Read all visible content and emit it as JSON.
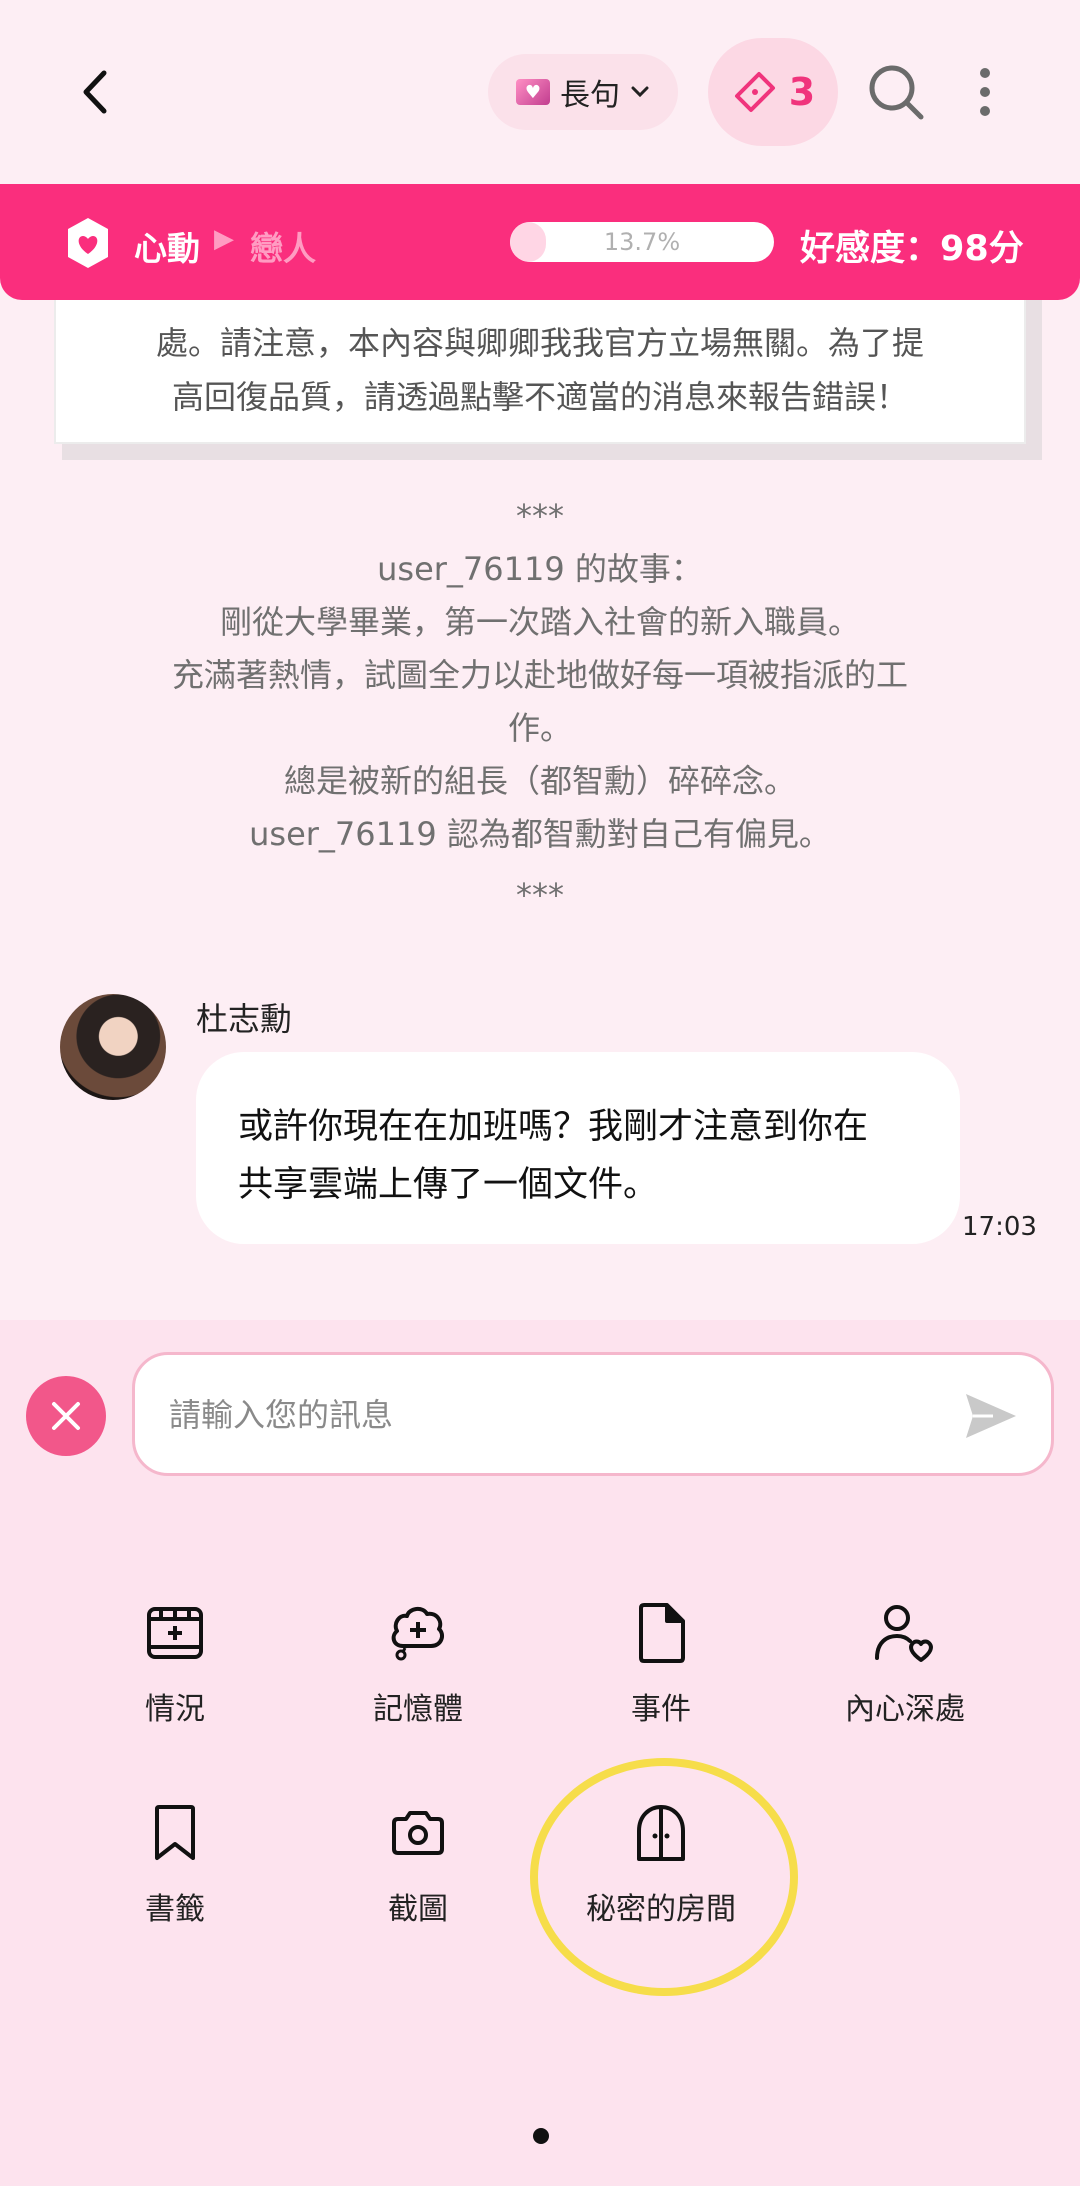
{
  "header": {
    "mode_label": "長句",
    "ticket_count": "3"
  },
  "affinity": {
    "stage_current": "心動",
    "stage_next": "戀人",
    "progress_text": "13.7%",
    "progress_fraction": 0.137,
    "score_text": "好感度：98分"
  },
  "disclaimer": {
    "line1": "處。請注意，本內容與卿卿我我官方立場無關。為了提",
    "line2": "高回復品質，請透過點擊不適當的消息來報告錯誤！"
  },
  "story": {
    "stars_top": "***",
    "title": "user_76119 的故事：",
    "line1": "剛從大學畢業，第一次踏入社會的新入職員。",
    "line2a": "充滿著熱情，試圖全力以赴地做好每一項被指派的工",
    "line2b": "作。",
    "line3": "總是被新的組長（都智勳）碎碎念。",
    "line4": "user_76119 認為都智勳對自己有偏見。",
    "stars_bottom": "***"
  },
  "message": {
    "sender": "杜志勳",
    "line1": "或許你現在在加班嗎？我剛才注意到你在",
    "line2": "共享雲端上傳了一個文件。",
    "time": "17:03"
  },
  "composer": {
    "placeholder": "請輸入您的訊息"
  },
  "tools": [
    {
      "label": "情況",
      "icon": "film-plus-icon"
    },
    {
      "label": "記憶體",
      "icon": "brain-plus-icon"
    },
    {
      "label": "事件",
      "icon": "file-icon"
    },
    {
      "label": "內心深處",
      "icon": "user-heart-icon"
    },
    {
      "label": "書籤",
      "icon": "bookmark-icon"
    },
    {
      "label": "截圖",
      "icon": "camera-icon"
    },
    {
      "label": "秘密的房間",
      "icon": "door-icon"
    }
  ],
  "colors": {
    "brand_pink": "#fa2e7d",
    "background": "#fdeef4",
    "highlight_ring": "#f6dd4a"
  }
}
